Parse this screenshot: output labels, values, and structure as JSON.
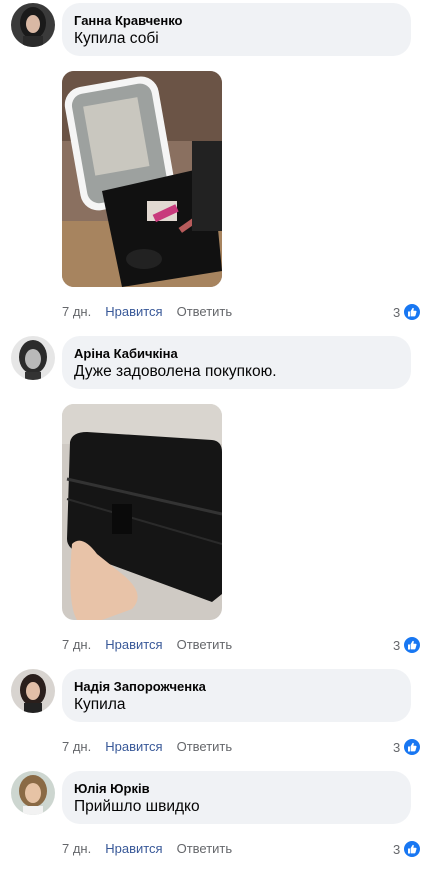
{
  "comments": [
    {
      "author": "Ганна Кравченко",
      "text": "Купила собі",
      "time": "7 дн.",
      "like_label": "Нравится",
      "reply_label": "Ответить",
      "reaction_count": "3",
      "reaction_icon": "like-icon"
    },
    {
      "author": "Аріна Кабичкіна",
      "text": "Дуже задоволена покупкою.",
      "time": "7 дн.",
      "like_label": "Нравится",
      "reply_label": "Ответить",
      "reaction_count": "3",
      "reaction_icon": "like-icon"
    },
    {
      "author": "Надія Запорожченка",
      "text": "Купила",
      "time": "7 дн.",
      "like_label": "Нравится",
      "reply_label": "Ответить",
      "reaction_count": "3",
      "reaction_icon": "like-icon"
    },
    {
      "author": "Юлія Юрків",
      "text": "Прийшло швидко",
      "time": "7 дн.",
      "like_label": "Нравится",
      "reply_label": "Ответить",
      "reaction_count": "3",
      "reaction_icon": "like-icon"
    }
  ],
  "colors": {
    "bubble": "#f0f2f5",
    "link": "#385898",
    "muted": "#65676b",
    "like_blue": "#1877f2"
  }
}
